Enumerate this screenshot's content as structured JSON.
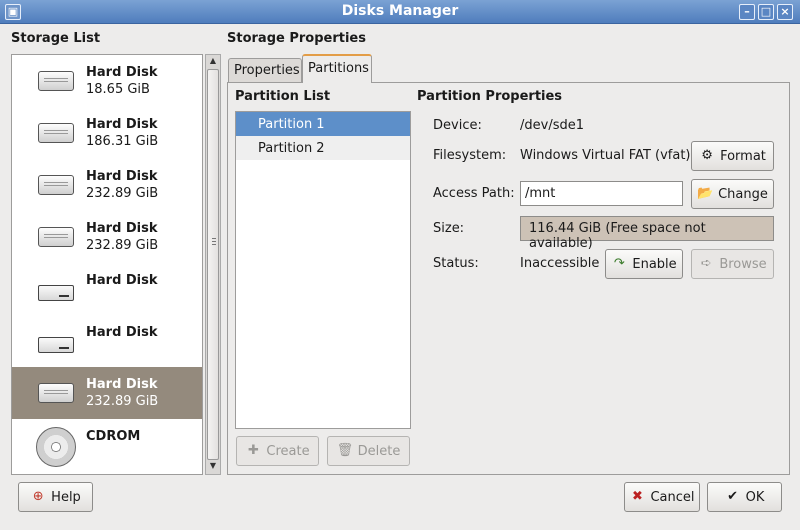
{
  "window": {
    "title": "Disks Manager",
    "menu_icon": "window-menu-icon",
    "controls": [
      "minimize",
      "maximize",
      "close"
    ]
  },
  "storage": {
    "title": "Storage List",
    "items": [
      {
        "name": "Hard Disk",
        "size": "18.65 GiB",
        "icon": "hard-disk-icon"
      },
      {
        "name": "Hard Disk",
        "size": "186.31 GiB",
        "icon": "hard-disk-icon"
      },
      {
        "name": "Hard Disk",
        "size": "232.89 GiB",
        "icon": "hard-disk-icon"
      },
      {
        "name": "Hard Disk",
        "size": "232.89 GiB",
        "icon": "hard-disk-icon"
      },
      {
        "name": "Hard Disk",
        "size": "",
        "icon": "removable-disk-icon"
      },
      {
        "name": "Hard Disk",
        "size": "",
        "icon": "removable-disk-icon"
      },
      {
        "name": "Hard Disk",
        "size": "232.89 GiB",
        "icon": "hard-disk-icon",
        "selected": true
      },
      {
        "name": "CDROM",
        "size": "",
        "icon": "cdrom-icon"
      }
    ]
  },
  "properties": {
    "title": "Storage Properties",
    "tabs": [
      {
        "label": "Properties"
      },
      {
        "label": "Partitions",
        "active": true
      }
    ],
    "partition_list": {
      "title": "Partition List",
      "items": [
        {
          "label": "Partition 1",
          "selected": true
        },
        {
          "label": "Partition 2"
        }
      ]
    },
    "partition_props": {
      "title": "Partition Properties",
      "device": {
        "label": "Device:",
        "value": "/dev/sde1"
      },
      "filesystem": {
        "label": "Filesystem:",
        "value": "Windows Virtual FAT (vfat)"
      },
      "access_path": {
        "label": "Access Path:",
        "value": "/mnt"
      },
      "size": {
        "label": "Size:",
        "value": "116.44 GiB (Free space not available)"
      },
      "status": {
        "label": "Status:",
        "value": "Inaccessible"
      }
    },
    "buttons": {
      "format": "Format",
      "change": "Change",
      "enable": "Enable",
      "browse": "Browse",
      "create": "Create",
      "delete": "Delete"
    }
  },
  "footer": {
    "help": "Help",
    "cancel": "Cancel",
    "ok": "OK"
  }
}
